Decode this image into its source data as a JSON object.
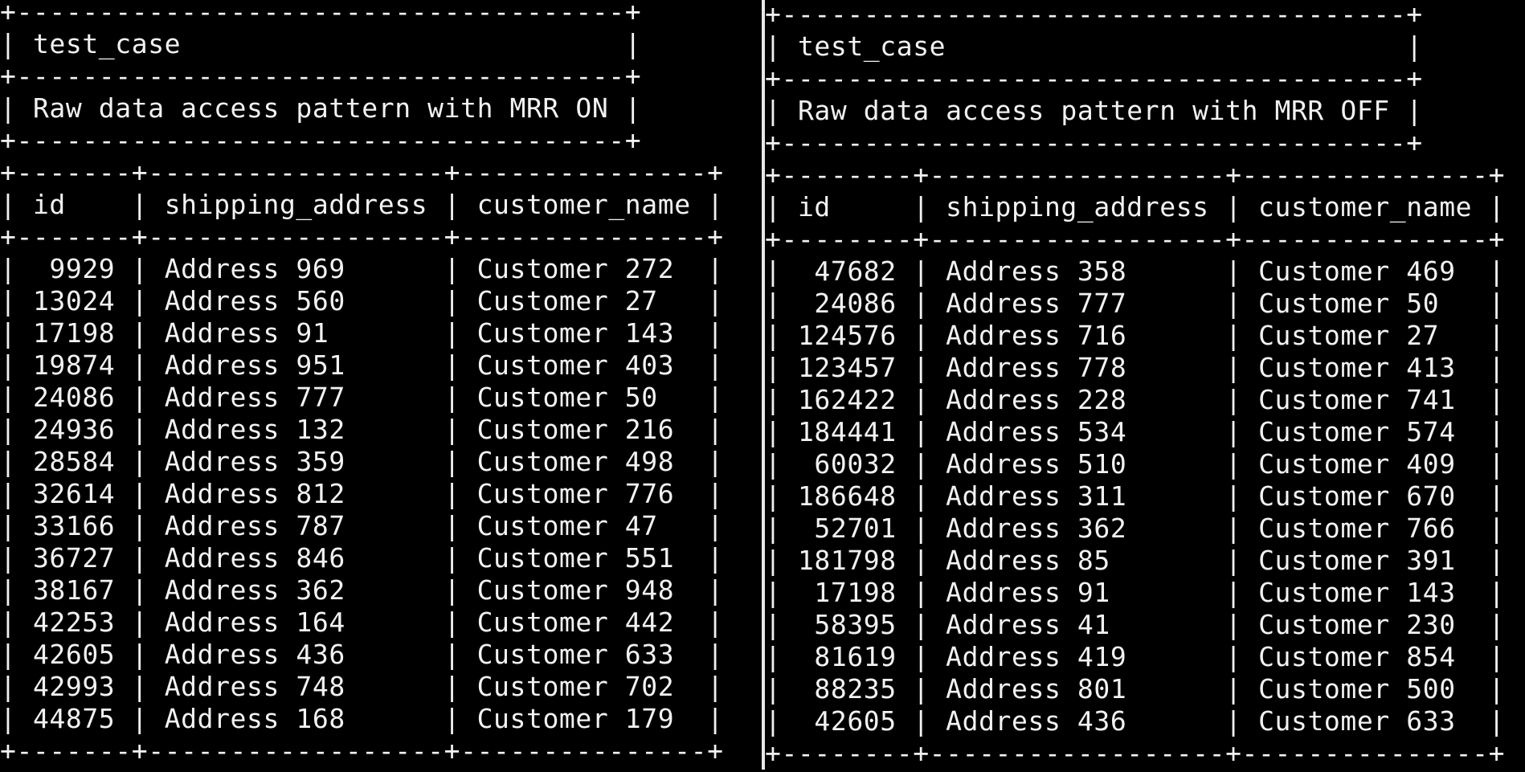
{
  "left_result": {
    "header_column": "test_case",
    "test_case": "Raw data access pattern with MRR ON",
    "columns": [
      "id",
      "shipping_address",
      "customer_name"
    ],
    "rows": [
      [
        "9929",
        "Address 969",
        "Customer 272"
      ],
      [
        "13024",
        "Address 560",
        "Customer 27"
      ],
      [
        "17198",
        "Address 91",
        "Customer 143"
      ],
      [
        "19874",
        "Address 951",
        "Customer 403"
      ],
      [
        "24086",
        "Address 777",
        "Customer 50"
      ],
      [
        "24936",
        "Address 132",
        "Customer 216"
      ],
      [
        "28584",
        "Address 359",
        "Customer 498"
      ],
      [
        "32614",
        "Address 812",
        "Customer 776"
      ],
      [
        "33166",
        "Address 787",
        "Customer 47"
      ],
      [
        "36727",
        "Address 846",
        "Customer 551"
      ],
      [
        "38167",
        "Address 362",
        "Customer 948"
      ],
      [
        "42253",
        "Address 164",
        "Customer 442"
      ],
      [
        "42605",
        "Address 436",
        "Customer 633"
      ],
      [
        "42993",
        "Address 748",
        "Customer 702"
      ],
      [
        "44875",
        "Address 168",
        "Customer 179"
      ]
    ]
  },
  "right_result": {
    "header_column": "test_case",
    "test_case": "Raw data access pattern with MRR OFF",
    "columns": [
      "id",
      "shipping_address",
      "customer_name"
    ],
    "rows": [
      [
        "47682",
        "Address 358",
        "Customer 469"
      ],
      [
        "24086",
        "Address 777",
        "Customer 50"
      ],
      [
        "124576",
        "Address 716",
        "Customer 27"
      ],
      [
        "123457",
        "Address 778",
        "Customer 413"
      ],
      [
        "162422",
        "Address 228",
        "Customer 741"
      ],
      [
        "184441",
        "Address 534",
        "Customer 574"
      ],
      [
        "60032",
        "Address 510",
        "Customer 409"
      ],
      [
        "186648",
        "Address 311",
        "Customer 670"
      ],
      [
        "52701",
        "Address 362",
        "Customer 766"
      ],
      [
        "181798",
        "Address 85",
        "Customer 391"
      ],
      [
        "17198",
        "Address 91",
        "Customer 143"
      ],
      [
        "58395",
        "Address 41",
        "Customer 230"
      ],
      [
        "81619",
        "Address 419",
        "Customer 854"
      ],
      [
        "88235",
        "Address 801",
        "Customer 500"
      ],
      [
        "42605",
        "Address 436",
        "Customer 633"
      ]
    ]
  }
}
